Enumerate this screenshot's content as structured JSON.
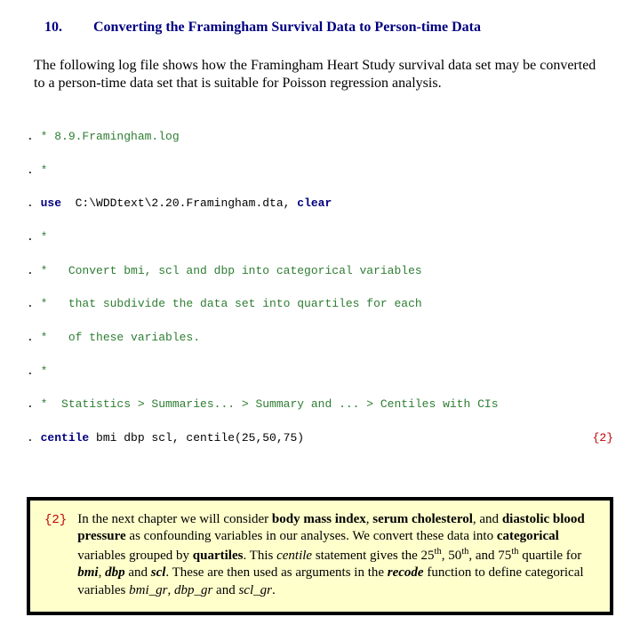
{
  "heading": {
    "number": "10.",
    "text": "Converting the Framingham Survival Data to Person-time Data"
  },
  "intro": "The following log file shows how the Framingham Heart Study survival data set may be converted to a person-time data set that is suitable for Poisson regression analysis.",
  "code": {
    "l1_cmt": "* 8.9.Framingham.log",
    "l2_cmt": "*",
    "l3_use": "use",
    "l3_path": "  C:\\WDDtext\\2.20.Framingham.dta,",
    "l3_clear": " clear",
    "l4_cmt": "*",
    "l5_cmt": "*   Convert bmi, scl and dbp into categorical variables",
    "l6_cmt": "*   that subdivide the data set into quartiles for each",
    "l7_cmt": "*   of these variables.",
    "l8_cmt": "*",
    "l9_cmt": "*  Statistics > Summaries... > Summary and ... > Centiles with CIs",
    "l10_centile": "centile",
    "l10_args": " bmi dbp scl, centile(25,50,75)",
    "l10_annot": "{2}"
  },
  "note": {
    "label": "{2}",
    "t1": "In the next chapter we will consider ",
    "b1": "body mass index",
    "t2": ", ",
    "b2": "serum cholesterol",
    "t3": ", and ",
    "b3": "diastolic blood pressure",
    "t4": " as confounding variables in our analyses.  We convert these data into ",
    "b4": "categorical",
    "t5": " variables grouped by ",
    "b5": "quartiles",
    "t6": ".  This ",
    "i1": "centile",
    "t7": " statement gives the 25",
    "sup1": "th",
    "t8": ", 50",
    "sup2": "th",
    "t9": ", and 75",
    "sup3": "th",
    "t10": " quartile for ",
    "bi1": "bmi",
    "t11": ", ",
    "bi2": "dbp",
    "t12": " and ",
    "bi3": "scl",
    "t13": ".  These are then used as arguments in the ",
    "bi4": "recode",
    "t14": " function to define categorical variables ",
    "i2": "bmi_gr",
    "t15": ", ",
    "i3": "dbp_gr",
    "t16": " and ",
    "i4": "scl_gr",
    "t17": "."
  }
}
